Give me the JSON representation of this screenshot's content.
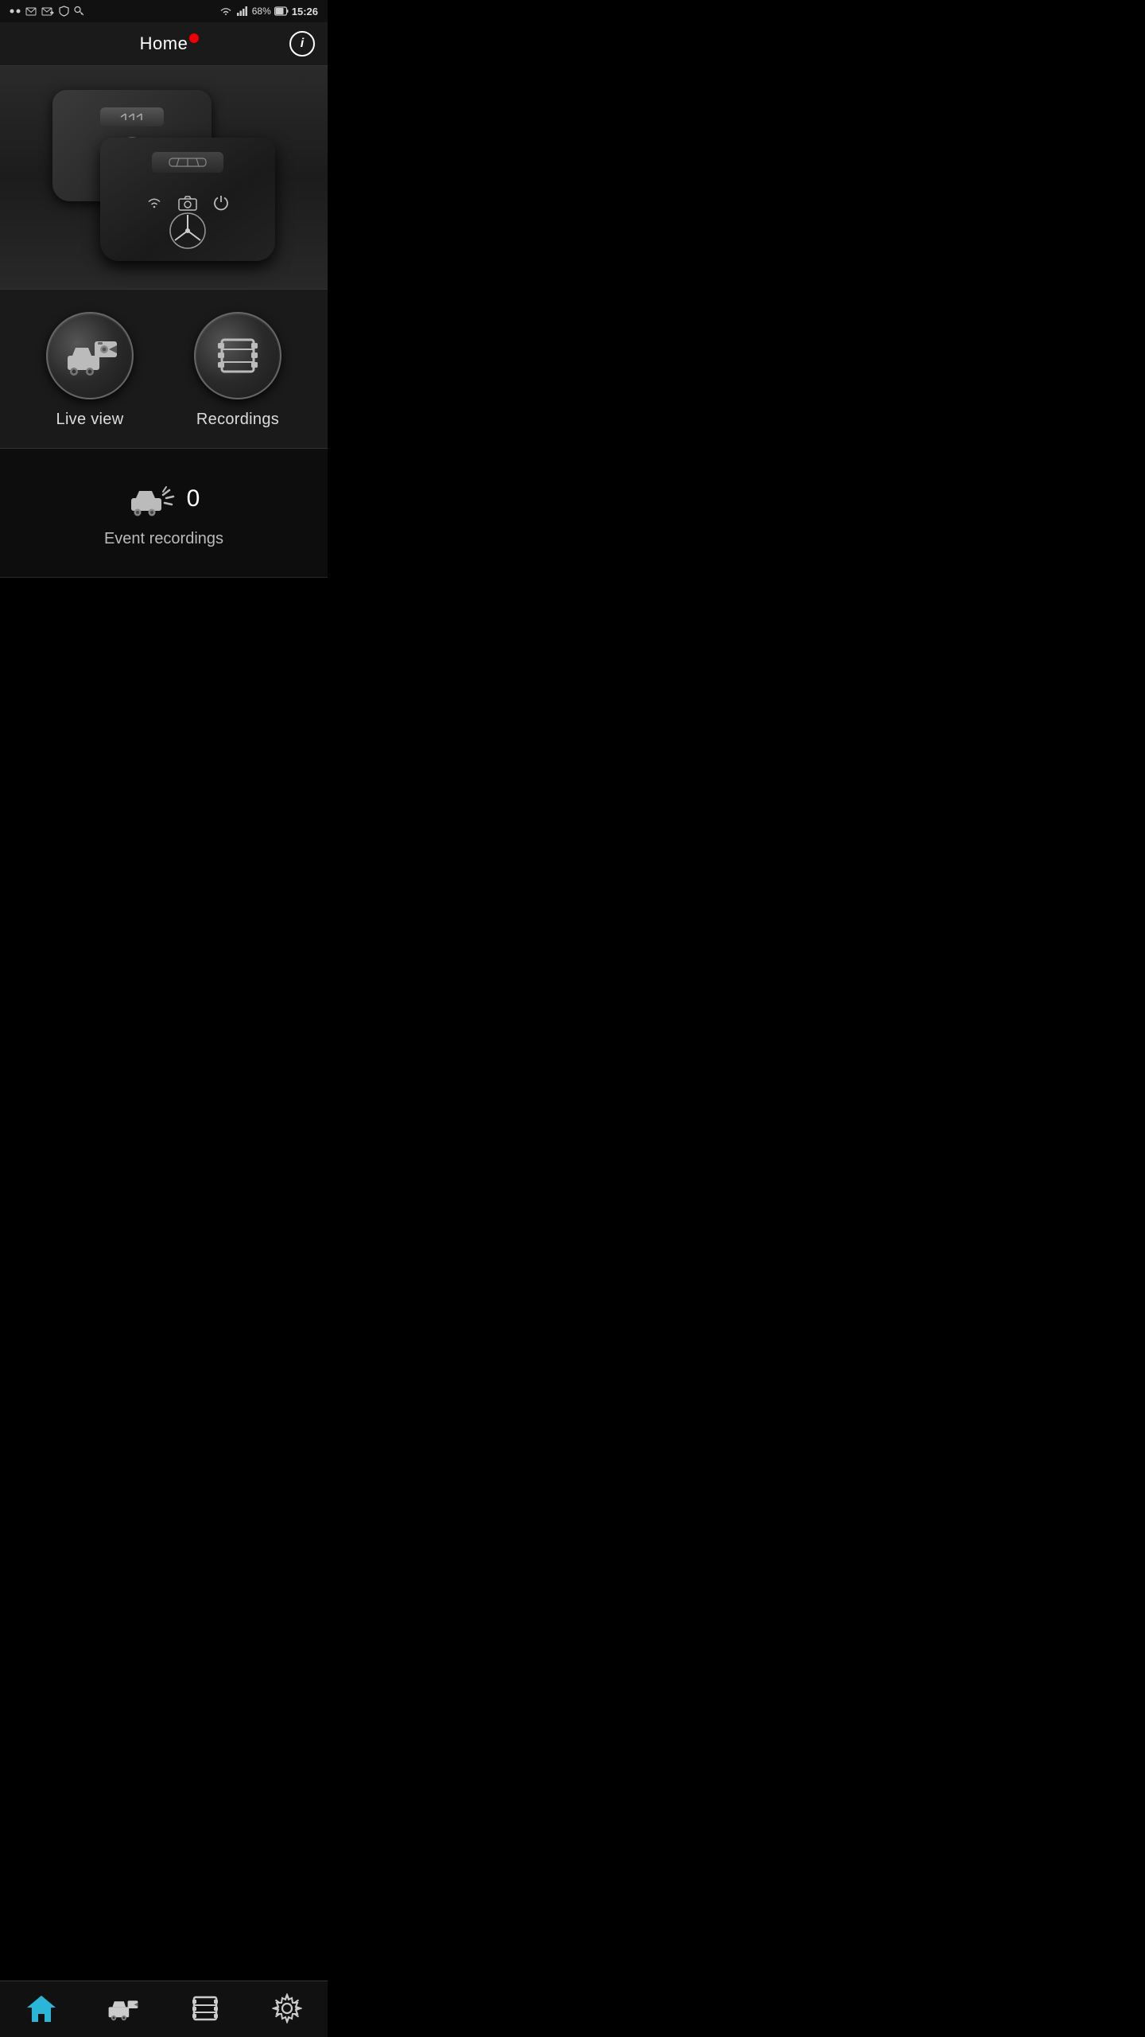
{
  "statusBar": {
    "battery": "68%",
    "time": "15:26"
  },
  "header": {
    "title": "Home",
    "infoButton": "i"
  },
  "actions": {
    "liveView": {
      "label": "Live view"
    },
    "recordings": {
      "label": "Recordings"
    }
  },
  "events": {
    "count": "0",
    "label": "Event recordings"
  },
  "bottomNav": {
    "home": "home",
    "liveview": "live-view",
    "recordings": "recordings",
    "settings": "settings"
  }
}
